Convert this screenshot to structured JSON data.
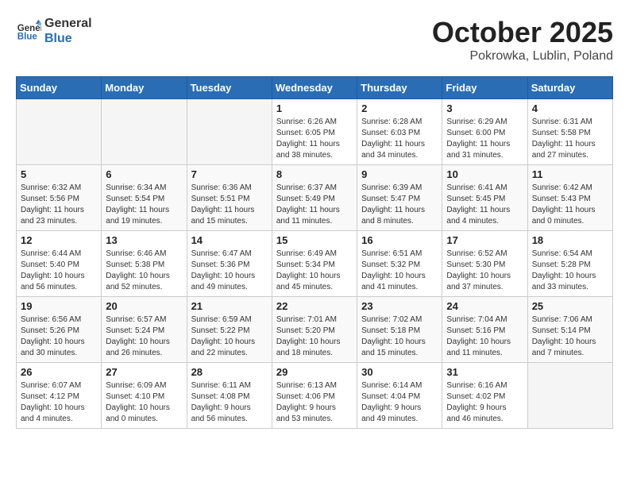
{
  "header": {
    "logo_line1": "General",
    "logo_line2": "Blue",
    "month_year": "October 2025",
    "location": "Pokrowka, Lublin, Poland"
  },
  "weekdays": [
    "Sunday",
    "Monday",
    "Tuesday",
    "Wednesday",
    "Thursday",
    "Friday",
    "Saturday"
  ],
  "weeks": [
    [
      {
        "day": "",
        "info": ""
      },
      {
        "day": "",
        "info": ""
      },
      {
        "day": "",
        "info": ""
      },
      {
        "day": "1",
        "info": "Sunrise: 6:26 AM\nSunset: 6:05 PM\nDaylight: 11 hours\nand 38 minutes."
      },
      {
        "day": "2",
        "info": "Sunrise: 6:28 AM\nSunset: 6:03 PM\nDaylight: 11 hours\nand 34 minutes."
      },
      {
        "day": "3",
        "info": "Sunrise: 6:29 AM\nSunset: 6:00 PM\nDaylight: 11 hours\nand 31 minutes."
      },
      {
        "day": "4",
        "info": "Sunrise: 6:31 AM\nSunset: 5:58 PM\nDaylight: 11 hours\nand 27 minutes."
      }
    ],
    [
      {
        "day": "5",
        "info": "Sunrise: 6:32 AM\nSunset: 5:56 PM\nDaylight: 11 hours\nand 23 minutes."
      },
      {
        "day": "6",
        "info": "Sunrise: 6:34 AM\nSunset: 5:54 PM\nDaylight: 11 hours\nand 19 minutes."
      },
      {
        "day": "7",
        "info": "Sunrise: 6:36 AM\nSunset: 5:51 PM\nDaylight: 11 hours\nand 15 minutes."
      },
      {
        "day": "8",
        "info": "Sunrise: 6:37 AM\nSunset: 5:49 PM\nDaylight: 11 hours\nand 11 minutes."
      },
      {
        "day": "9",
        "info": "Sunrise: 6:39 AM\nSunset: 5:47 PM\nDaylight: 11 hours\nand 8 minutes."
      },
      {
        "day": "10",
        "info": "Sunrise: 6:41 AM\nSunset: 5:45 PM\nDaylight: 11 hours\nand 4 minutes."
      },
      {
        "day": "11",
        "info": "Sunrise: 6:42 AM\nSunset: 5:43 PM\nDaylight: 11 hours\nand 0 minutes."
      }
    ],
    [
      {
        "day": "12",
        "info": "Sunrise: 6:44 AM\nSunset: 5:40 PM\nDaylight: 10 hours\nand 56 minutes."
      },
      {
        "day": "13",
        "info": "Sunrise: 6:46 AM\nSunset: 5:38 PM\nDaylight: 10 hours\nand 52 minutes."
      },
      {
        "day": "14",
        "info": "Sunrise: 6:47 AM\nSunset: 5:36 PM\nDaylight: 10 hours\nand 49 minutes."
      },
      {
        "day": "15",
        "info": "Sunrise: 6:49 AM\nSunset: 5:34 PM\nDaylight: 10 hours\nand 45 minutes."
      },
      {
        "day": "16",
        "info": "Sunrise: 6:51 AM\nSunset: 5:32 PM\nDaylight: 10 hours\nand 41 minutes."
      },
      {
        "day": "17",
        "info": "Sunrise: 6:52 AM\nSunset: 5:30 PM\nDaylight: 10 hours\nand 37 minutes."
      },
      {
        "day": "18",
        "info": "Sunrise: 6:54 AM\nSunset: 5:28 PM\nDaylight: 10 hours\nand 33 minutes."
      }
    ],
    [
      {
        "day": "19",
        "info": "Sunrise: 6:56 AM\nSunset: 5:26 PM\nDaylight: 10 hours\nand 30 minutes."
      },
      {
        "day": "20",
        "info": "Sunrise: 6:57 AM\nSunset: 5:24 PM\nDaylight: 10 hours\nand 26 minutes."
      },
      {
        "day": "21",
        "info": "Sunrise: 6:59 AM\nSunset: 5:22 PM\nDaylight: 10 hours\nand 22 minutes."
      },
      {
        "day": "22",
        "info": "Sunrise: 7:01 AM\nSunset: 5:20 PM\nDaylight: 10 hours\nand 18 minutes."
      },
      {
        "day": "23",
        "info": "Sunrise: 7:02 AM\nSunset: 5:18 PM\nDaylight: 10 hours\nand 15 minutes."
      },
      {
        "day": "24",
        "info": "Sunrise: 7:04 AM\nSunset: 5:16 PM\nDaylight: 10 hours\nand 11 minutes."
      },
      {
        "day": "25",
        "info": "Sunrise: 7:06 AM\nSunset: 5:14 PM\nDaylight: 10 hours\nand 7 minutes."
      }
    ],
    [
      {
        "day": "26",
        "info": "Sunrise: 6:07 AM\nSunset: 4:12 PM\nDaylight: 10 hours\nand 4 minutes."
      },
      {
        "day": "27",
        "info": "Sunrise: 6:09 AM\nSunset: 4:10 PM\nDaylight: 10 hours\nand 0 minutes."
      },
      {
        "day": "28",
        "info": "Sunrise: 6:11 AM\nSunset: 4:08 PM\nDaylight: 9 hours\nand 56 minutes."
      },
      {
        "day": "29",
        "info": "Sunrise: 6:13 AM\nSunset: 4:06 PM\nDaylight: 9 hours\nand 53 minutes."
      },
      {
        "day": "30",
        "info": "Sunrise: 6:14 AM\nSunset: 4:04 PM\nDaylight: 9 hours\nand 49 minutes."
      },
      {
        "day": "31",
        "info": "Sunrise: 6:16 AM\nSunset: 4:02 PM\nDaylight: 9 hours\nand 46 minutes."
      },
      {
        "day": "",
        "info": ""
      }
    ]
  ]
}
